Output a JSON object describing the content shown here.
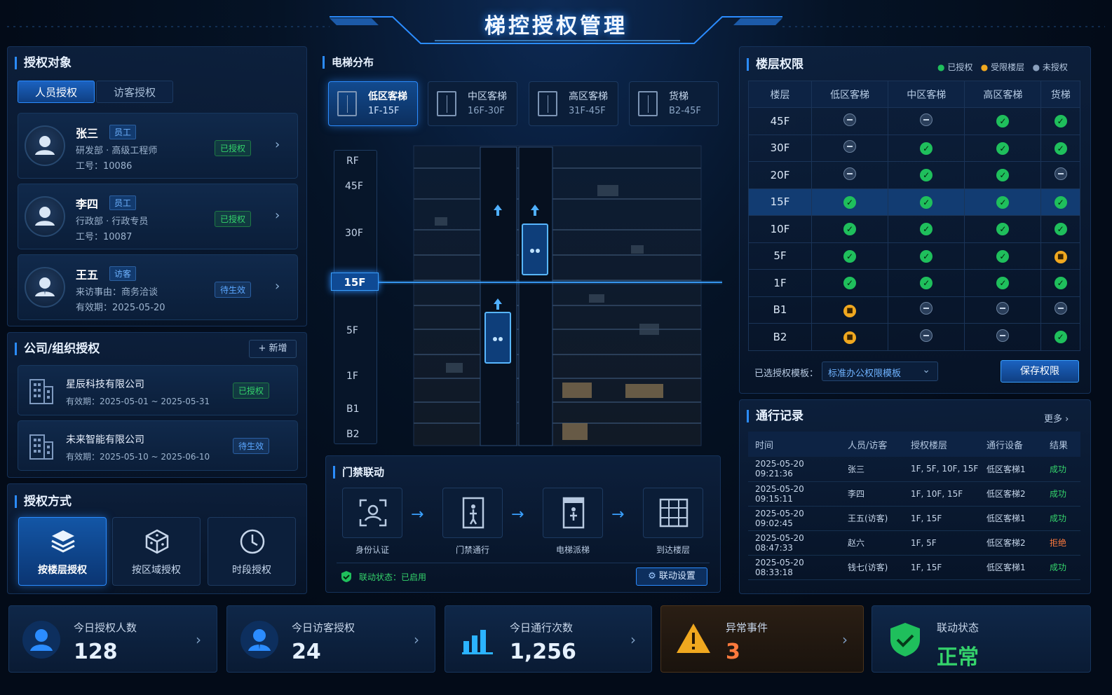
{
  "header": {
    "title": "梯控授权管理"
  },
  "auth_target": {
    "title": "授权对象",
    "tabs": [
      "人员授权",
      "访客授权"
    ],
    "people": [
      {
        "name": "张三",
        "tag": "员工",
        "line1": "研发部 · 高级工程师",
        "line2": "工号：10086",
        "status": "已授权"
      },
      {
        "name": "李四",
        "tag": "员工",
        "line1": "行政部 · 行政专员",
        "line2": "工号：10087",
        "status": "已授权"
      },
      {
        "name": "王五",
        "tag": "访客",
        "line1": "来访事由：商务洽谈",
        "line2": "有效期：2025-05-20",
        "status": "待生效"
      }
    ]
  },
  "org_auth": {
    "title": "公司/组织授权",
    "add_label": "+ 新增",
    "companies": [
      {
        "name": "星辰科技有限公司",
        "period": "有效期：2025-05-01 ~ 2025-05-31",
        "status": "已授权"
      },
      {
        "name": "未来智能有限公司",
        "period": "有效期：2025-05-10 ~ 2025-06-10",
        "status": "待生效"
      }
    ]
  },
  "auth_mode": {
    "title": "授权方式",
    "modes": [
      "按楼层授权",
      "按区域授权",
      "时段授权"
    ]
  },
  "elevator_dist": {
    "title": "电梯分布",
    "elevators": [
      {
        "name": "低区客梯",
        "range": "1F-15F"
      },
      {
        "name": "中区客梯",
        "range": "16F-30F"
      },
      {
        "name": "高区客梯",
        "range": "31F-45F"
      },
      {
        "name": "货梯",
        "range": "B2-45F"
      }
    ],
    "floor_labels": [
      "RF",
      "45F",
      "30F",
      "15F",
      "5F",
      "1F",
      "B1",
      "B2"
    ],
    "selected_floor": "15F"
  },
  "access_link": {
    "title": "门禁联动",
    "steps": [
      "身份认证",
      "门禁通行",
      "电梯派梯",
      "到达楼层"
    ],
    "status_text": "联动状态：已启用",
    "settings_label": "联动设置"
  },
  "floor_perm": {
    "title": "楼层权限",
    "legend": [
      "已授权",
      "受限楼层",
      "未授权"
    ],
    "legend_colors": [
      "#1fbf5c",
      "#f0a81f",
      "#8aa0bd"
    ],
    "columns": [
      "楼层",
      "低区客梯",
      "中区客梯",
      "高区客梯",
      "货梯"
    ],
    "rows": [
      {
        "floor": "45F",
        "cells": [
          "no",
          "no",
          "ok",
          "ok"
        ]
      },
      {
        "floor": "30F",
        "cells": [
          "no",
          "ok",
          "ok",
          "ok"
        ]
      },
      {
        "floor": "20F",
        "cells": [
          "no",
          "ok",
          "ok",
          "no"
        ]
      },
      {
        "floor": "15F",
        "cells": [
          "ok",
          "ok",
          "ok",
          "ok"
        ]
      },
      {
        "floor": "10F",
        "cells": [
          "ok",
          "ok",
          "ok",
          "ok"
        ]
      },
      {
        "floor": "5F",
        "cells": [
          "ok",
          "ok",
          "ok",
          "lock"
        ]
      },
      {
        "floor": "1F",
        "cells": [
          "ok",
          "ok",
          "ok",
          "ok"
        ]
      },
      {
        "floor": "B1",
        "cells": [
          "lock",
          "no",
          "no",
          "no"
        ]
      },
      {
        "floor": "B2",
        "cells": [
          "lock",
          "no",
          "no",
          "ok"
        ]
      }
    ],
    "template_label": "已选授权模板：",
    "template_value": "标准办公权限模板",
    "save_label": "保存权限"
  },
  "records": {
    "title": "通行记录",
    "more_label": "更多",
    "columns": [
      "时间",
      "人员/访客",
      "授权楼层",
      "通行设备",
      "结果"
    ],
    "rows": [
      [
        "2025-05-20 09:21:36",
        "张三",
        "1F, 5F, 10F, 15F",
        "低区客梯1",
        "成功"
      ],
      [
        "2025-05-20 09:15:11",
        "李四",
        "1F, 10F, 15F",
        "低区客梯2",
        "成功"
      ],
      [
        "2025-05-20 09:02:45",
        "王五(访客)",
        "1F, 15F",
        "低区客梯1",
        "成功"
      ],
      [
        "2025-05-20 08:47:33",
        "赵六",
        "1F, 5F",
        "低区客梯2",
        "拒绝"
      ],
      [
        "2025-05-20 08:33:18",
        "钱七(访客)",
        "1F, 15F",
        "低区客梯1",
        "成功"
      ]
    ]
  },
  "stats": [
    {
      "label": "今日授权人数",
      "value": "128"
    },
    {
      "label": "今日访客授权",
      "value": "24"
    },
    {
      "label": "今日通行次数",
      "value": "1,256"
    },
    {
      "label": "异常事件",
      "value": "3"
    },
    {
      "label": "联动状态",
      "value": "正常"
    }
  ],
  "colors": {
    "accent": "#2b8cff",
    "success": "#1fbf5c",
    "warning": "#f0a81f",
    "danger": "#ff6a3d"
  }
}
